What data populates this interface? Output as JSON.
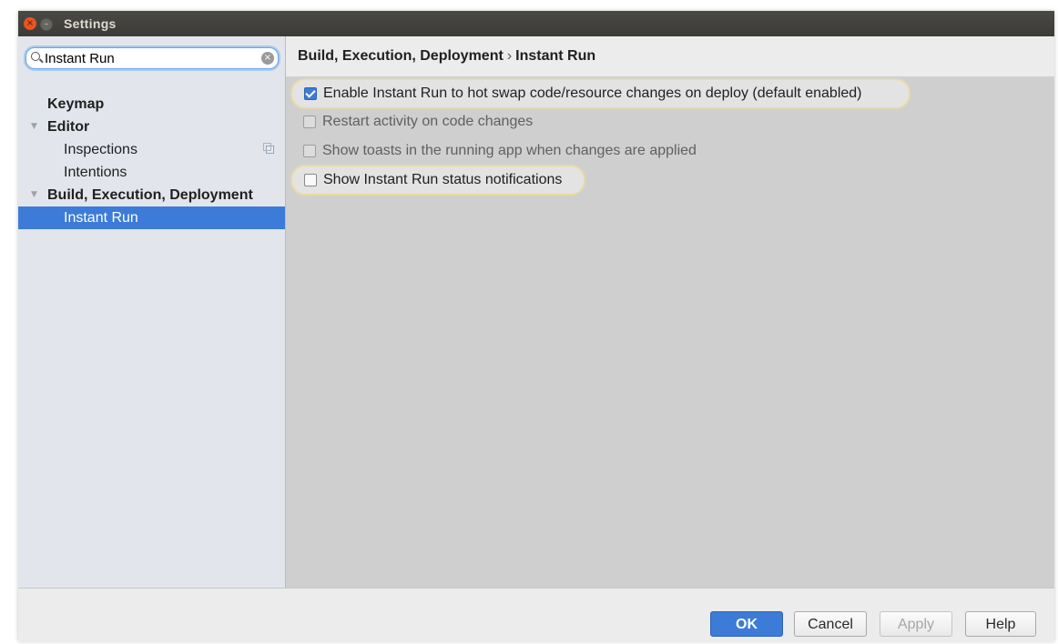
{
  "window": {
    "title": "Settings",
    "close_glyph": "×",
    "minimize_glyph": "–"
  },
  "search": {
    "value": "Instant Run",
    "clear_glyph": "×"
  },
  "tree": {
    "arrow_glyph": "▼",
    "items": [
      {
        "label": "Keymap"
      },
      {
        "label": "Editor"
      },
      {
        "label": "Inspections"
      },
      {
        "label": "Intentions"
      },
      {
        "label": "Build, Execution, Deployment"
      },
      {
        "label": "Instant Run",
        "selected": true
      }
    ]
  },
  "breadcrumb": {
    "parent": "Build, Execution, Deployment",
    "separator": "›",
    "current": "Instant Run"
  },
  "options": [
    {
      "label": "Enable Instant Run to hot swap code/resource changes on deploy (default enabled)",
      "checked": true,
      "enabled": true,
      "highlighted": true
    },
    {
      "label": "Restart activity on code changes",
      "checked": false,
      "enabled": false,
      "highlighted": false
    },
    {
      "label": "Show toasts in the running app when changes are applied",
      "checked": false,
      "enabled": false,
      "highlighted": false
    },
    {
      "label": "Show Instant Run status notifications",
      "checked": false,
      "enabled": true,
      "highlighted": true
    }
  ],
  "footer": {
    "ok_label": "OK",
    "cancel_label": "Cancel",
    "apply_label": "Apply",
    "help_label": "Help"
  },
  "colors": {
    "accent": "#3d7bd8",
    "highlight_outline": "#f2dc8a",
    "titlebar": "#3c3b37",
    "close_button": "#e95420"
  },
  "icons": [
    "close-icon",
    "minimize-icon",
    "search-icon",
    "clear-search-icon",
    "tree-arrow-icon",
    "copy-icon",
    "checkbox-checked-icon"
  ]
}
